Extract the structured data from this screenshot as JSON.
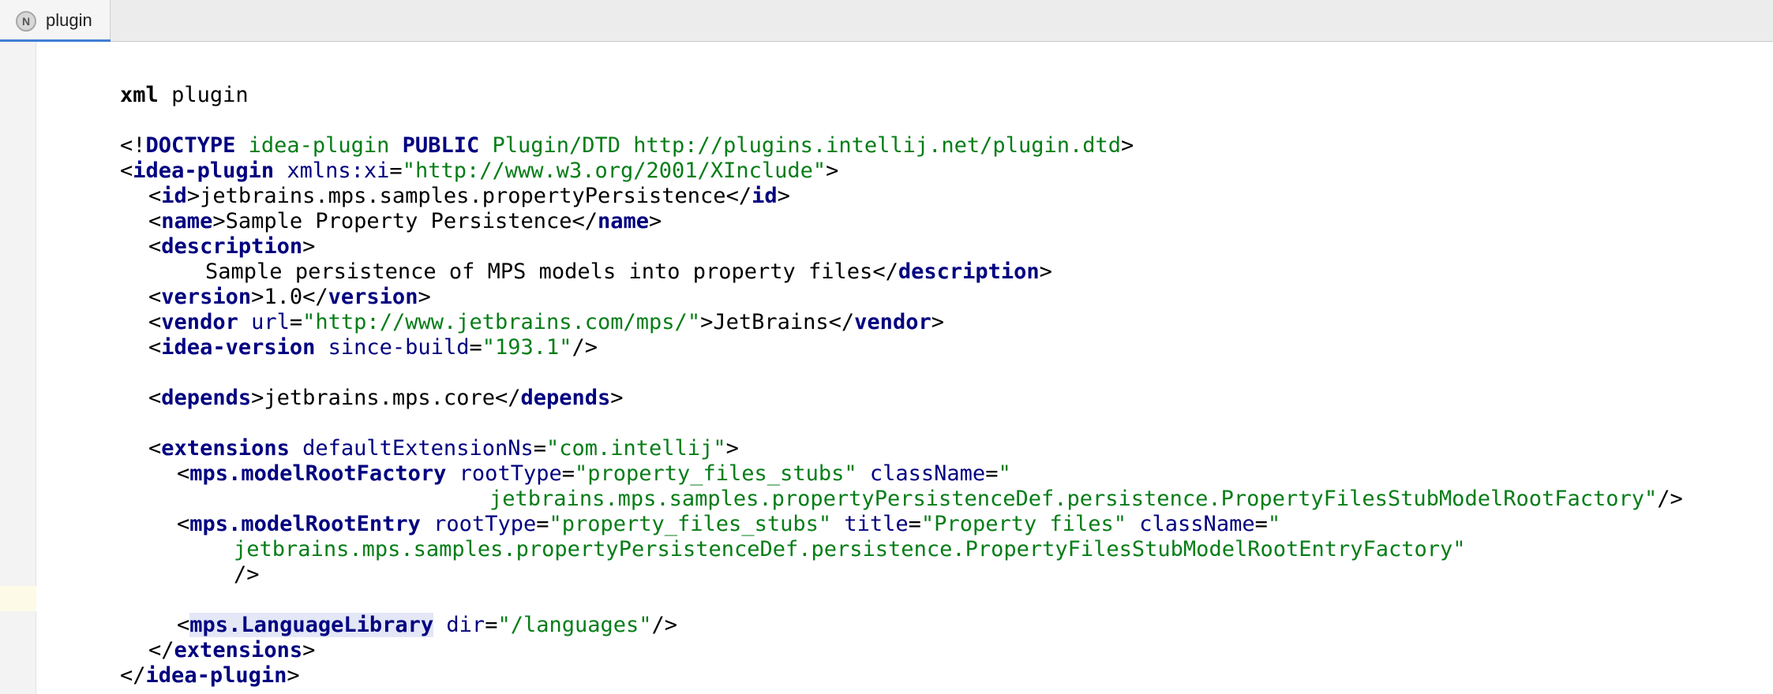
{
  "tab": {
    "icon_letter": "N",
    "label": "plugin"
  },
  "lines": {
    "l01": [
      "xml",
      " plugin"
    ],
    "l03": [
      "<!",
      "DOCTYPE",
      " idea-plugin ",
      "PUBLIC",
      " Plugin/DTD http://plugins.intellij.net/plugin.dtd",
      ">"
    ],
    "l04": [
      "<",
      "idea-plugin",
      " ",
      "xmlns:xi",
      "=",
      "\"http://www.w3.org/2001/XInclude\"",
      ">"
    ],
    "l05": [
      "<",
      "id",
      ">",
      "jetbrains.mps.samples.propertyPersistence",
      "</",
      "id",
      ">"
    ],
    "l06": [
      "<",
      "name",
      ">",
      "Sample Property Persistence",
      "</",
      "name",
      ">"
    ],
    "l07": [
      "<",
      "description",
      ">"
    ],
    "l08": [
      "Sample persistence of MPS models into property files",
      "</",
      "description",
      ">"
    ],
    "l09": [
      "<",
      "version",
      ">",
      "1.0",
      "</",
      "version",
      ">"
    ],
    "l10": [
      "<",
      "vendor",
      " ",
      "url",
      "=",
      "\"http://www.jetbrains.com/mps/\"",
      ">",
      "JetBrains",
      "</",
      "vendor",
      ">"
    ],
    "l11": [
      "<",
      "idea-version",
      " ",
      "since-build",
      "=",
      "\"193.1\"",
      "/>"
    ],
    "l13": [
      "<",
      "depends",
      ">",
      "jetbrains.mps.core",
      "</",
      "depends",
      ">"
    ],
    "l15": [
      "<",
      "extensions",
      " ",
      "defaultExtensionNs",
      "=",
      "\"com.intellij\"",
      ">"
    ],
    "l16": [
      "<",
      "mps.modelRootFactory",
      " ",
      "rootType",
      "=",
      "\"property_files_stubs\"",
      " ",
      "className",
      "=",
      "\""
    ],
    "l17": [
      "jetbrains.mps.samples.propertyPersistenceDef.persistence.PropertyFilesStubModelRootFactory\"",
      "/>"
    ],
    "l18": [
      "<",
      "mps.modelRootEntry",
      " ",
      "rootType",
      "=",
      "\"property_files_stubs\"",
      " ",
      "title",
      "=",
      "\"Property files\"",
      " ",
      "className",
      "=",
      "\""
    ],
    "l19": [
      "jetbrains.mps.samples.propertyPersistenceDef.persistence.PropertyFilesStubModelRootEntryFactory\""
    ],
    "l20": [
      "/>"
    ],
    "l22": [
      "<",
      "mps.LanguageLibrary",
      " ",
      "dir",
      "=",
      "\"/languages\"",
      "/>"
    ],
    "l23": [
      "</",
      "extensions",
      ">"
    ],
    "l24": [
      "</",
      "idea-plugin",
      ">"
    ]
  }
}
